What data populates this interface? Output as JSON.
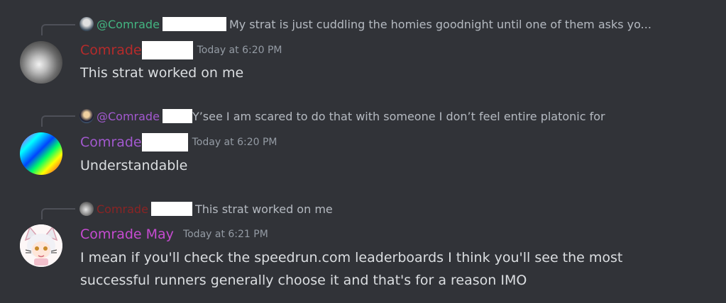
{
  "colors": {
    "background": "#313338",
    "mention": "#43b581",
    "name_red": "#b52b2b",
    "name_purple": "#a259cf",
    "name_pink": "#c64bd1",
    "text": "#dbdee1",
    "muted": "#949ba4"
  },
  "messages": [
    {
      "reply": {
        "name": "@Comrade",
        "text": "My strat is just cuddling the homies goodnight until one of them asks yo..."
      },
      "author": "Comrade",
      "timestamp": "Today at 6:20 PM",
      "content": "This strat worked on me"
    },
    {
      "reply": {
        "name": "@Comrade",
        "text": "Y’see I am scared to do that with someone I don’t feel entire platonic for"
      },
      "author": "Comrade",
      "timestamp": "Today at 6:20 PM",
      "content": "Understandable"
    },
    {
      "reply": {
        "name": "Comrade",
        "text": "This strat worked on me"
      },
      "author": "Comrade May",
      "timestamp": "Today at 6:21 PM",
      "content_lines": [
        "I mean if you'll check the speedrun.com leaderboards I think you'll see the most",
        "successful runners generally choose it and that's for a reason IMO"
      ]
    }
  ]
}
